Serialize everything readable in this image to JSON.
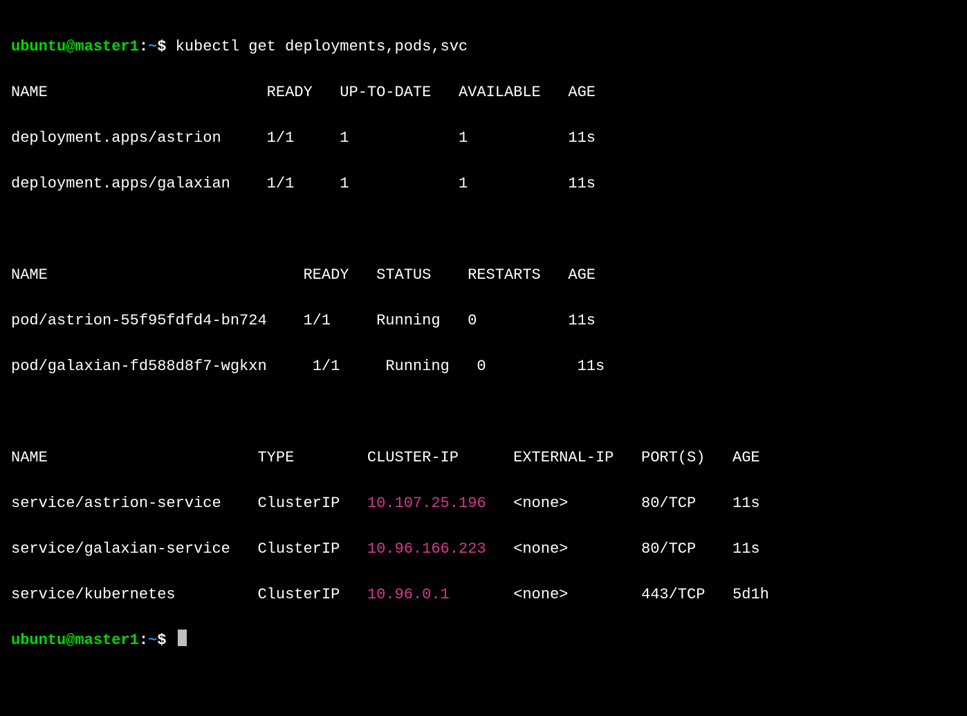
{
  "prompt": {
    "user": "ubuntu",
    "at_host": "@master1",
    "colon": ":",
    "path": "~",
    "dollar": "$"
  },
  "command": "kubectl get deployments,pods,svc",
  "deployments": {
    "header": {
      "name": "NAME",
      "ready": "READY",
      "uptodate": "UP-TO-DATE",
      "available": "AVAILABLE",
      "age": "AGE"
    },
    "rows": [
      {
        "name": "deployment.apps/astrion",
        "ready": "1/1",
        "uptodate": "1",
        "available": "1",
        "age": "11s"
      },
      {
        "name": "deployment.apps/galaxian",
        "ready": "1/1",
        "uptodate": "1",
        "available": "1",
        "age": "11s"
      }
    ]
  },
  "pods": {
    "header": {
      "name": "NAME",
      "ready": "READY",
      "status": "STATUS",
      "restarts": "RESTARTS",
      "age": "AGE"
    },
    "rows": [
      {
        "name": "pod/astrion-55f95fdfd4-bn724",
        "ready": "1/1",
        "status": "Running",
        "restarts": "0",
        "age": "11s"
      },
      {
        "name": "pod/galaxian-fd588d8f7-wgkxn",
        "ready": "1/1",
        "status": "Running",
        "restarts": "0",
        "age": "11s"
      }
    ]
  },
  "services": {
    "header": {
      "name": "NAME",
      "type": "TYPE",
      "clusterip": "CLUSTER-IP",
      "externalip": "EXTERNAL-IP",
      "ports": "PORT(S)",
      "age": "AGE"
    },
    "rows": [
      {
        "name": "service/astrion-service",
        "type": "ClusterIP",
        "clusterip": "10.107.25.196",
        "externalip": "<none>",
        "ports": "80/TCP",
        "age": "11s"
      },
      {
        "name": "service/galaxian-service",
        "type": "ClusterIP",
        "clusterip": "10.96.166.223",
        "externalip": "<none>",
        "ports": "80/TCP",
        "age": "11s"
      },
      {
        "name": "service/kubernetes",
        "type": "ClusterIP",
        "clusterip": "10.96.0.1",
        "externalip": "<none>",
        "ports": "443/TCP",
        "age": "5d1h"
      }
    ]
  }
}
